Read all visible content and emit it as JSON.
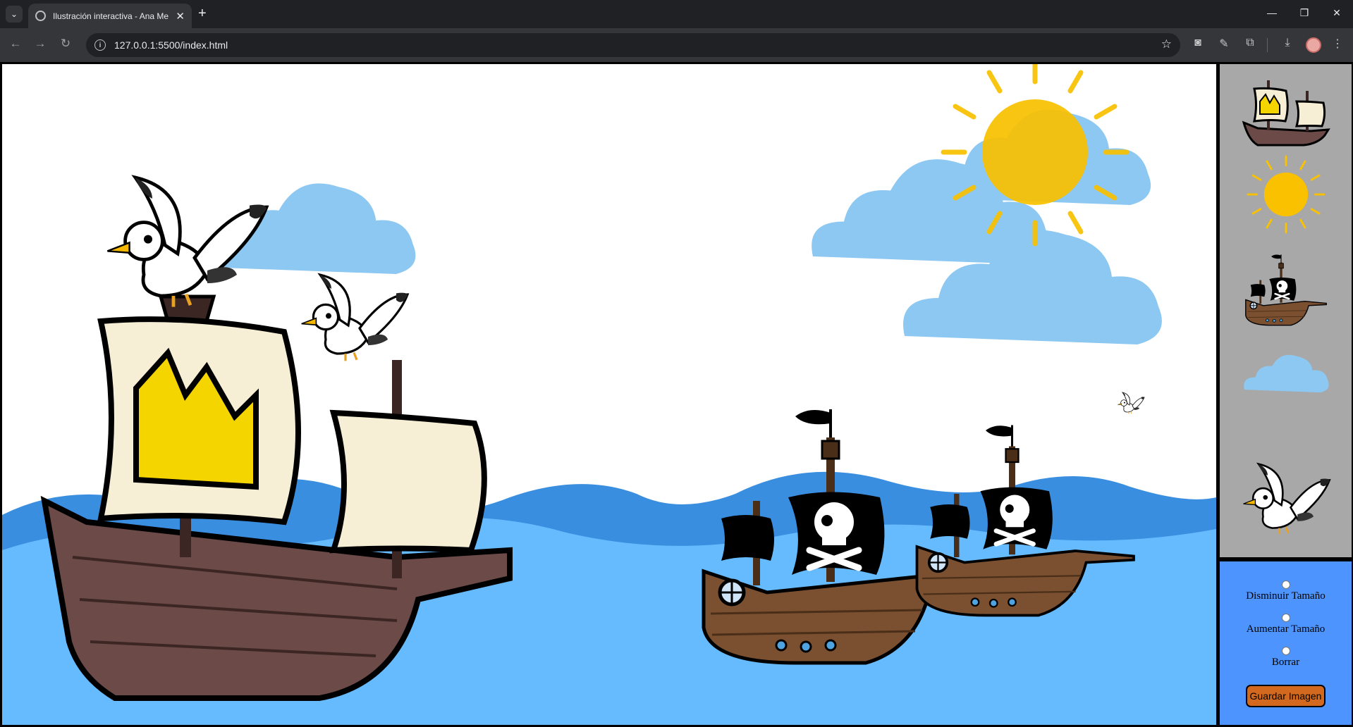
{
  "browser": {
    "tab_title": "Ilustración interactiva - Ana Me",
    "url": "127.0.0.1:5500/index.html",
    "icons": [
      "tab-search-icon",
      "globe-icon",
      "close-icon",
      "plus-icon",
      "minimize-icon",
      "restore-icon",
      "close-window-icon",
      "back-icon",
      "forward-icon",
      "reload-icon",
      "info-icon",
      "star-icon",
      "camera-icon",
      "eyedropper-icon",
      "extensions-icon",
      "download-icon",
      "avatar",
      "kebab-menu-icon"
    ]
  },
  "palette": {
    "items": [
      "royal-ship",
      "sun",
      "pirate-ship",
      "cloud",
      "seagull"
    ]
  },
  "controls": {
    "decrease_label": "Disminuir Tamaño",
    "increase_label": "Aumentar Tamaño",
    "erase_label": "Borrar",
    "save_label": "Guardar Imagen"
  },
  "colors": {
    "sky": "#ffffff",
    "sea_light": "#66bbff",
    "sea_dark": "#3a8ee0",
    "cloud": "#8cc8f2",
    "sun": "#f9c100",
    "palette_bg": "#a8a8a8",
    "controls_bg": "#4d94ff",
    "save_button": "#d2691e"
  }
}
